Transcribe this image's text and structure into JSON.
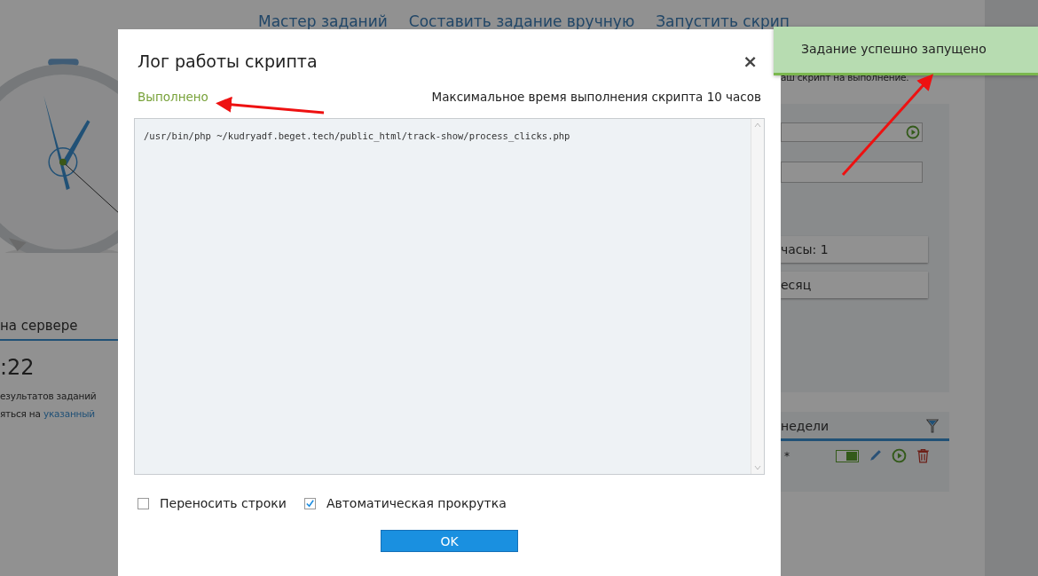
{
  "background_page": {
    "nav_links": [
      "Мастер заданий",
      "Составить задание вручную",
      "Запустить скрип"
    ],
    "hint_text": "аш скрипт на выполнение.",
    "settings_rows": [
      "часы: 1",
      "есяц"
    ],
    "server_tab": "на сервере",
    "server_time": ":22",
    "notice_line": "езультатов заданий",
    "notice_text": "яться на",
    "notice_link": "указанный",
    "tasks_header": "недели",
    "task_row": {
      "schedule": "*",
      "enabled": true
    }
  },
  "dialog": {
    "title": "Лог работы скрипта",
    "close": "×",
    "status": "Выполнено",
    "max_time": "Максимальное время выполнения скрипта 10 часов",
    "log_lines": [
      "/usr/bin/php ~/kudryadf.beget.tech/public_html/track-show/process_clicks.php"
    ],
    "options": [
      {
        "label": "Переносить строки",
        "checked": false
      },
      {
        "label": "Автоматическая прокрутка",
        "checked": true
      }
    ],
    "ok_button": "OK"
  },
  "toast": {
    "message": "Задание успешно запущено"
  }
}
